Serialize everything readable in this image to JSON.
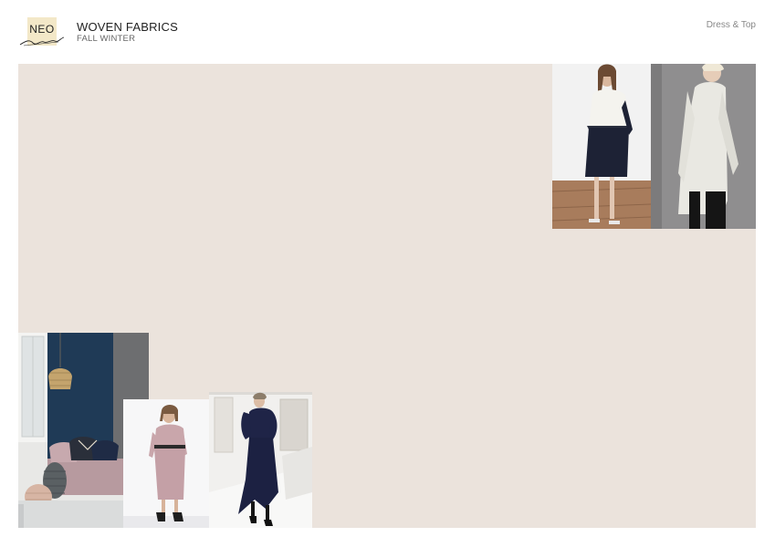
{
  "brand": {
    "logo_text": "NEO"
  },
  "header": {
    "title": "WOVEN FABRICS",
    "subtitle": "FALL WINTER",
    "category": "Dress & Top"
  },
  "colors": {
    "board_background": "#ebe3dc",
    "logo_background": "#f3e8c8"
  }
}
